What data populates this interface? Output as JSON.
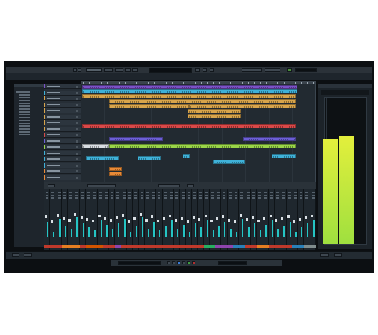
{
  "app": {
    "title": "",
    "background": "#0c0f12"
  },
  "toolbar": {
    "buttons": [
      "undo",
      "redo",
      "select",
      "range",
      "split",
      "glue",
      "erase",
      "zoom",
      "mute",
      "draw",
      "play"
    ],
    "icons": [
      "arrow-icon",
      "range-icon",
      "scissors-icon",
      "glue-icon",
      "eraser-icon",
      "zoom-icon",
      "mute-icon",
      "pencil-icon",
      "play-icon"
    ]
  },
  "inspector": {
    "tabs": [
      "",
      ""
    ],
    "row_count": 14
  },
  "tracks": [
    {
      "color": "#7b52c7"
    },
    {
      "color": "#3fb1d8"
    },
    {
      "color": "#d7a44b"
    },
    {
      "color": "#d7a44b"
    },
    {
      "color": "#d7a44b"
    },
    {
      "color": "#d7a44b"
    },
    {
      "color": "#d7a44b"
    },
    {
      "color": "#d7a44b"
    },
    {
      "color": "#d94848"
    },
    {
      "color": "#6c5fd6"
    },
    {
      "color": "#9ad548"
    },
    {
      "color": "#3fb1d8"
    },
    {
      "color": "#3fb1d8"
    },
    {
      "color": "#3fb1d8"
    },
    {
      "color": "#e88a37"
    },
    {
      "color": "#e88a37"
    }
  ],
  "colors": {
    "accent_cyan": "#25c4c4",
    "meter_green": "#9fe03f",
    "meter_yellow": "#e3ef3c",
    "audio_event": "#d7a44b",
    "red_event": "#d94848",
    "purple_event": "#7b52c7",
    "green_event": "#9ad548",
    "blue_event": "#3fb1d8",
    "orange_event": "#e88a37"
  },
  "mixer": {
    "channel_count": 46,
    "levels": [
      0.55,
      0.2,
      0.65,
      0.4,
      0.3,
      0.7,
      0.5,
      0.35,
      0.25,
      0.6,
      0.45,
      0.3,
      0.5,
      0.65,
      0.2,
      0.4,
      0.7,
      0.3,
      0.55,
      0.25,
      0.4,
      0.6,
      0.3,
      0.45,
      0.2,
      0.5,
      0.35,
      0.6,
      0.25,
      0.4,
      0.55,
      0.3,
      0.2,
      0.65,
      0.35,
      0.5,
      0.25,
      0.45,
      0.6,
      0.3,
      0.4,
      0.55,
      0.2,
      0.35,
      0.5,
      0.6
    ],
    "name_colors": [
      "#c0392b",
      "#c0392b",
      "#c0392b",
      "#e67e22",
      "#e67e22",
      "#e67e22",
      "#c0392b",
      "#d35400",
      "#d35400",
      "#d35400",
      "#c0392b",
      "#c0392b",
      "#8e44ad",
      "#c0392b",
      "#c0392b",
      "#c0392b",
      "#c0392b",
      "#c0392b",
      "#c0392b",
      "#c0392b",
      "#c0392b",
      "#c0392b",
      "#c0392b",
      "#c0392b",
      "#c0392b",
      "#c0392b",
      "#c0392b",
      "#27ae60",
      "#27ae60",
      "#8e44ad",
      "#8e44ad",
      "#8e44ad",
      "#2980b9",
      "#2980b9",
      "#c0392b",
      "#c0392b",
      "#e67e22",
      "#e67e22",
      "#c0392b",
      "#c0392b",
      "#c0392b",
      "#c0392b",
      "#2980b9",
      "#2980b9",
      "#7f8c8d",
      "#7f8c8d"
    ]
  },
  "master_meter": {
    "left_level": 0.72,
    "right_level": 0.74
  }
}
